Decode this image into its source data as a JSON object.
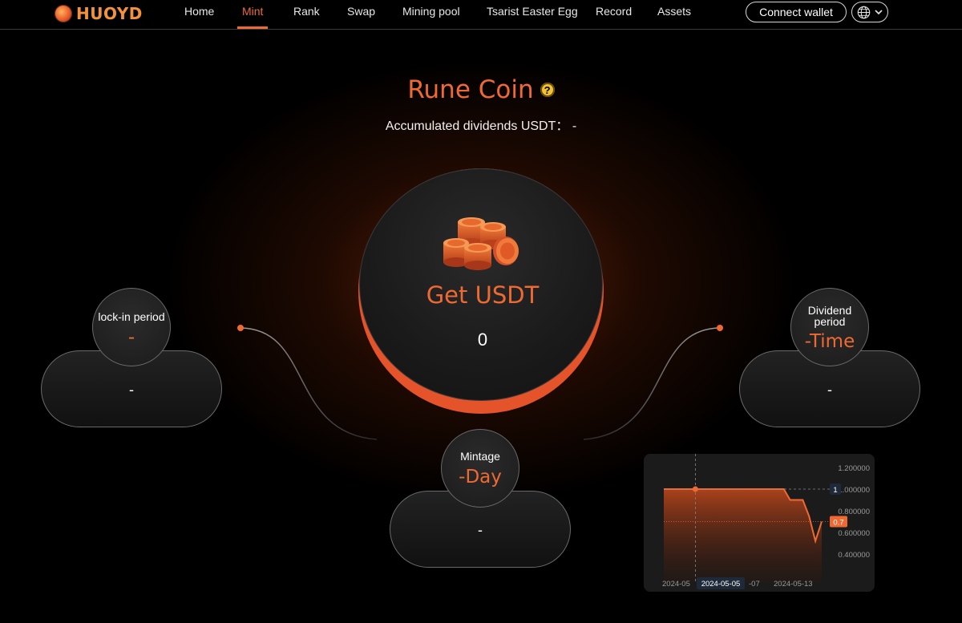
{
  "header": {
    "logo_text": "HUOYD",
    "nav": [
      {
        "label": "Home",
        "active": false
      },
      {
        "label": "Mint",
        "active": true
      },
      {
        "label": "Rank",
        "active": false
      },
      {
        "label": "Swap",
        "active": false
      },
      {
        "label": "Mining pool",
        "active": false
      },
      {
        "label": "Tsarist Easter Egg",
        "active": false
      },
      {
        "label": "Record",
        "active": false
      },
      {
        "label": "Assets",
        "active": false
      }
    ],
    "connect_wallet": "Connect wallet",
    "language_icon": "globe-icon"
  },
  "hero": {
    "title": "Rune Coin",
    "help_glyph": "?",
    "subtitle_label": "Accumulated dividends USDT：",
    "subtitle_value": "-"
  },
  "main": {
    "get_label": "Get USDT",
    "get_value": "0",
    "coins_icon": "coins-icon"
  },
  "lock_in": {
    "label": "lock-in period",
    "value": "-",
    "panel_value": "-"
  },
  "dividend": {
    "label_line1": "Dividend",
    "label_line2": "period",
    "value": "-Time",
    "panel_value": "-"
  },
  "mintage": {
    "label": "Mintage",
    "value": "-Day",
    "panel_value": "-"
  },
  "colors": {
    "accent": "#ef6a33",
    "help": "#f2c230",
    "background": "#000000"
  },
  "chart_data": {
    "type": "area",
    "y_ticks": [
      "1.200000",
      "1.000000",
      "0.800000",
      "0.600000",
      "0.400000"
    ],
    "ylim": [
      0.4,
      1.2
    ],
    "x_labels": [
      "2024-05",
      "2024-05-05",
      "-07",
      "2024-05-13"
    ],
    "crosshair_x_label": "2024-05-05",
    "crosshair_y_label": "1",
    "last_value_label": "0.7",
    "last_value": 0.7,
    "series": [
      {
        "values": [
          1.0,
          1.0,
          1.0,
          1.0,
          1.0,
          1.0,
          1.0,
          1.0,
          1.0,
          1.0,
          1.0,
          1.0,
          1.0,
          1.0,
          1.0,
          1.0,
          1.0,
          1.0,
          1.0,
          1.0,
          0.9,
          0.9,
          0.9,
          0.75,
          0.52,
          0.7
        ]
      }
    ]
  }
}
